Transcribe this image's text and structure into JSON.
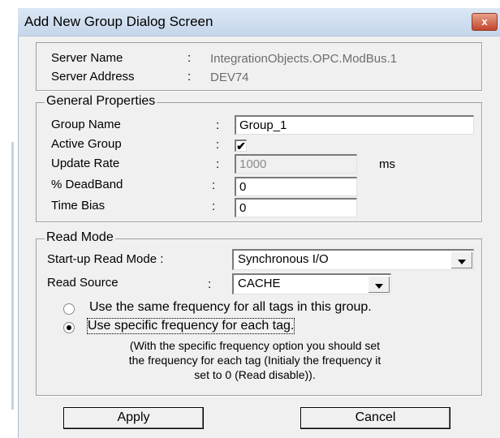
{
  "window": {
    "title": "Add New Group Dialog Screen",
    "close_glyph": "x"
  },
  "server": {
    "name_label": "Server Name",
    "name_sep": ":",
    "name_value": "IntegrationObjects.OPC.ModBus.1",
    "address_label": "Server Address",
    "address_sep": ":",
    "address_value": "DEV74"
  },
  "general": {
    "legend": "General  Properties",
    "sep": ":",
    "group_name_label": "Group Name",
    "group_name_value": "Group_1",
    "active_group_label": "Active Group",
    "active_group_checked": true,
    "update_rate_label": "Update Rate",
    "update_rate_value": "1000",
    "update_rate_unit": "ms",
    "deadband_label": "% DeadBand",
    "deadband_value": "0",
    "time_bias_label": "Time Bias",
    "time_bias_value": "0"
  },
  "read_mode": {
    "legend": "Read Mode",
    "startup_label": "Start-up Read Mode :",
    "startup_value": "Synchronous I/O",
    "source_label": "Read Source",
    "source_sep": ":",
    "source_value": "CACHE",
    "option_same": "Use the same frequency for all tags in this group.",
    "option_specific": "Use specific frequency for each tag.",
    "selected_option": "specific",
    "note_line1": "(With the specific frequency option you should set",
    "note_line2": "the frequency for each tag (Initialy the frequency it",
    "note_line3": "set to 0 (Read disable))."
  },
  "buttons": {
    "apply": "Apply",
    "cancel": "Cancel"
  },
  "icons": {
    "checkmark": "✔"
  }
}
